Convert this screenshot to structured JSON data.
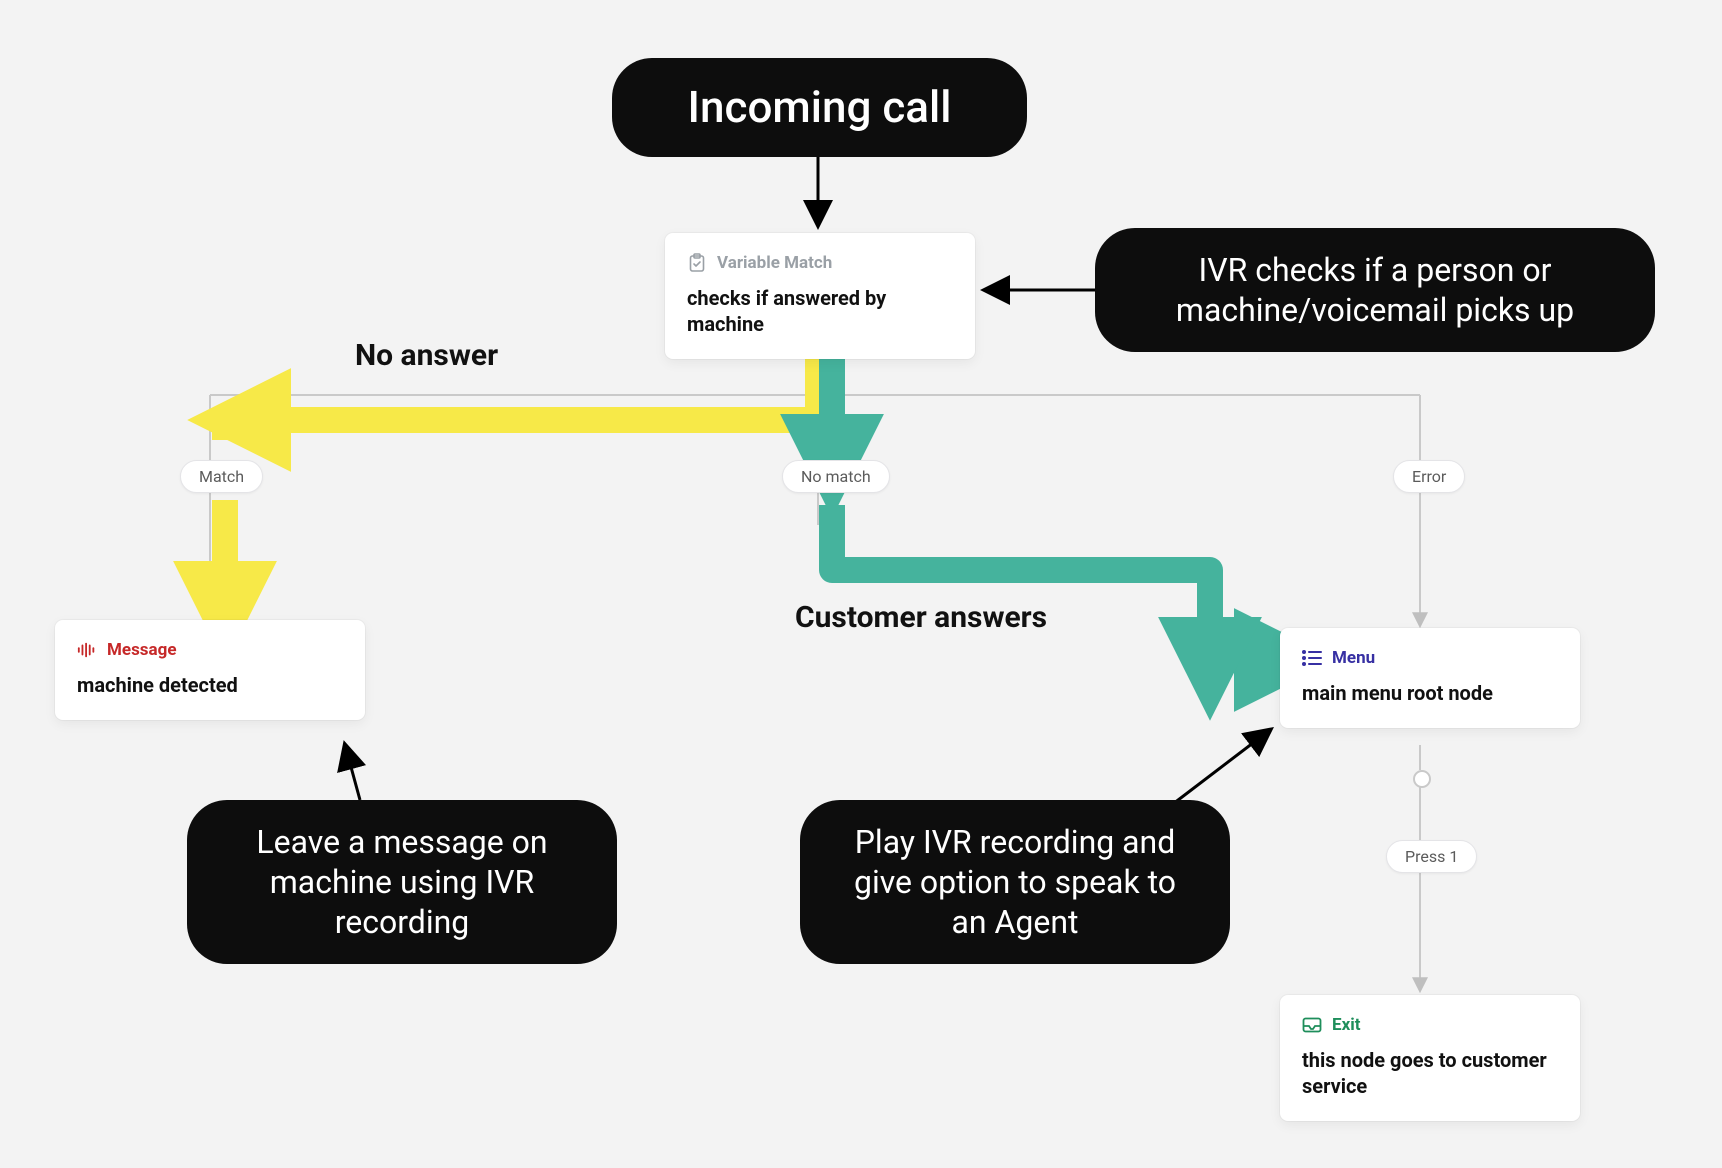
{
  "bubbles": {
    "incoming_call": "Incoming call",
    "ivr_checks": "IVR checks if a person or machine/voicemail picks up",
    "leave_message": "Leave a message on machine using IVR recording",
    "play_ivr": "Play IVR recording and give option to speak to an Agent"
  },
  "labels": {
    "no_answer": "No answer",
    "customer_answers": "Customer answers"
  },
  "pills": {
    "match": "Match",
    "no_match": "No match",
    "error": "Error",
    "press1": "Press 1"
  },
  "cards": {
    "variable_match": {
      "type": "Variable Match",
      "title": "checks if answered by machine"
    },
    "message": {
      "type": "Message",
      "title": "machine detected"
    },
    "menu": {
      "type": "Menu",
      "title": "main menu root node"
    },
    "exit": {
      "type": "Exit",
      "title": "this node goes to customer service"
    }
  }
}
